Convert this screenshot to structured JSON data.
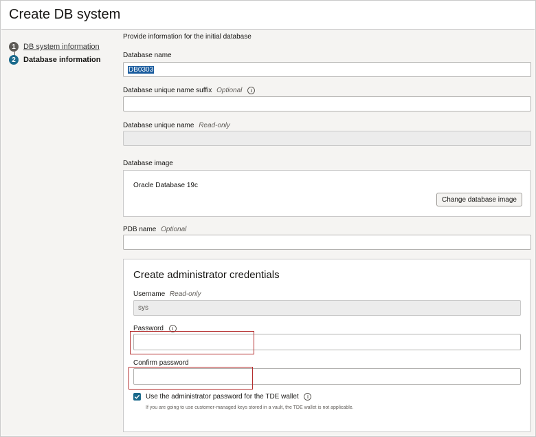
{
  "header": {
    "title": "Create DB system"
  },
  "steps": [
    {
      "number": "1",
      "label": "DB system information"
    },
    {
      "number": "2",
      "label": "Database information"
    }
  ],
  "form": {
    "section_note": "Provide information for the initial database",
    "db_name": {
      "label": "Database name",
      "value": "DB0303"
    },
    "unique_suffix": {
      "label": "Database unique name suffix",
      "optional": "Optional",
      "value": ""
    },
    "unique_name": {
      "label": "Database unique name",
      "readonly": "Read-only",
      "value": ""
    },
    "image": {
      "label": "Database image",
      "value": "Oracle Database 19c",
      "change_button": "Change database image"
    },
    "pdb": {
      "label": "PDB name",
      "optional": "Optional",
      "value": ""
    },
    "credentials": {
      "title": "Create administrator credentials",
      "username": {
        "label": "Username",
        "readonly": "Read-only",
        "value": "sys"
      },
      "password": {
        "label": "Password",
        "value": ""
      },
      "confirm": {
        "label": "Confirm password",
        "value": ""
      },
      "tde": {
        "label": "Use the administrator password for the TDE wallet",
        "checked": true,
        "help": "If you are going to use customer-managed keys stored in a vault, the TDE wallet is not applicable."
      }
    }
  },
  "colors": {
    "accent": "#1b6a8c",
    "highlight": "#b42d2d",
    "panel": "#f5f4f2"
  },
  "icons": {
    "info": "info-icon",
    "check": "checkmark-icon"
  }
}
